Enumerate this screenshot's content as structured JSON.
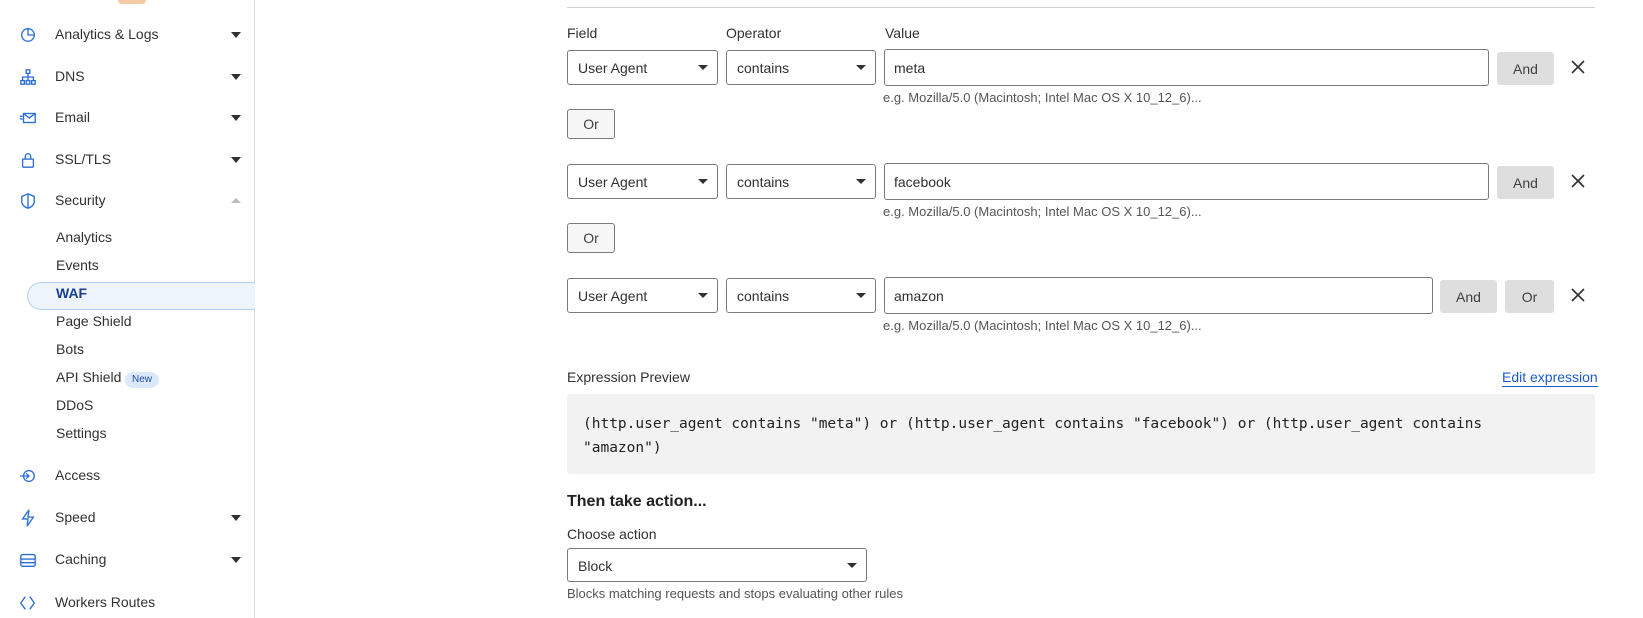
{
  "sidebar": {
    "items": [
      {
        "label": "Analytics & Logs",
        "icon": "pie-chart-icon"
      },
      {
        "label": "DNS",
        "icon": "network-icon"
      },
      {
        "label": "Email",
        "icon": "email-icon"
      },
      {
        "label": "SSL/TLS",
        "icon": "lock-icon"
      },
      {
        "label": "Security",
        "icon": "shield-icon"
      },
      {
        "label": "Access",
        "icon": "access-icon"
      },
      {
        "label": "Speed",
        "icon": "lightning-icon"
      },
      {
        "label": "Caching",
        "icon": "caching-icon"
      },
      {
        "label": "Workers Routes",
        "icon": "workers-icon"
      }
    ],
    "security_sub": [
      "Analytics",
      "Events",
      "WAF",
      "Page Shield",
      "Bots",
      "API Shield",
      "DDoS",
      "Settings"
    ],
    "active_sub": "WAF",
    "new_badge": "New"
  },
  "rule_builder": {
    "headers": {
      "field": "Field",
      "operator": "Operator",
      "value": "Value"
    },
    "rows": [
      {
        "field": "User Agent",
        "operator": "contains",
        "value": "meta",
        "and_label": "And",
        "or_label": "Or"
      },
      {
        "field": "User Agent",
        "operator": "contains",
        "value": "facebook",
        "and_label": "And",
        "or_label": "Or"
      },
      {
        "field": "User Agent",
        "operator": "contains",
        "value": "amazon",
        "and_label": "And",
        "or_label": "Or"
      }
    ],
    "hint": "e.g. Mozilla/5.0 (Macintosh; Intel Mac OS X 10_12_6)..."
  },
  "expression": {
    "label": "Expression Preview",
    "edit_link": "Edit expression",
    "text": "(http.user_agent contains \"meta\") or (http.user_agent contains \"facebook\") or (http.user_agent contains \"amazon\")"
  },
  "action": {
    "title": "Then take action...",
    "label": "Choose action",
    "selected": "Block",
    "description": "Blocks matching requests and stops evaluating other rules"
  },
  "colors": {
    "accent": "#1d5bd1",
    "nav_icon": "#2c6fd8",
    "active_bg": "#eef4fc"
  }
}
